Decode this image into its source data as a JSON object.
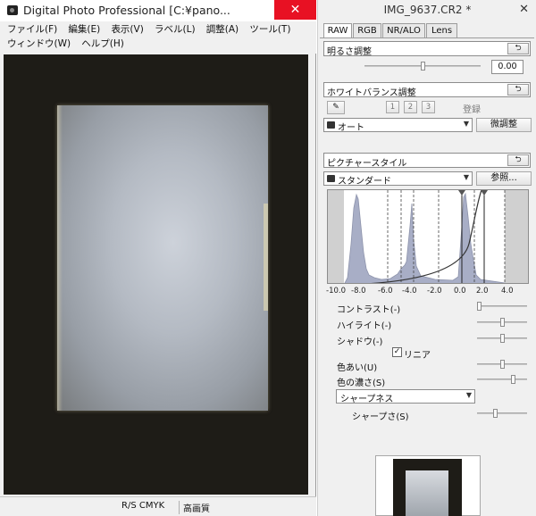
{
  "main_window": {
    "title": "Digital Photo Professional   [C:¥pano...",
    "close_glyph": "✕",
    "menu_row_1": [
      "ファイル(F)",
      "編集(E)",
      "表示(V)",
      "ラベル(L)",
      "調整(A)",
      "ツール(T)"
    ],
    "menu_row_2": [
      "ウィンドウ(W)",
      "ヘルプ(H)"
    ],
    "status": {
      "color_mode": "R/S CMYK",
      "quality": "高画質"
    }
  },
  "tool_palette": {
    "title": "IMG_9637.CR2 *",
    "close_glyph": "✕",
    "tabs": [
      "RAW",
      "RGB",
      "NR/ALO",
      "Lens"
    ],
    "active_tab": "RAW",
    "brightness": {
      "header": "明るさ調整",
      "reset_glyph": "⮌",
      "value": "0.00"
    },
    "white_balance": {
      "header": "ホワイトバランス調整",
      "reset_glyph": "⮌",
      "eyedropper_glyph": "✎",
      "presets": [
        "1",
        "2",
        "3"
      ],
      "register_label": "登録",
      "mode": "オート",
      "fine_tune_label": "微調整"
    },
    "picture_style": {
      "header": "ピクチャースタイル",
      "reset_glyph": "⮌",
      "style": "スタンダード",
      "browse_label": "参照..."
    },
    "histogram_axis": [
      "-10.0",
      "-8.0",
      "-6.0",
      "-4.0",
      "-2.0",
      "0.0",
      "2.0",
      "4.0"
    ],
    "adjustments": {
      "contrast": "コントラスト(-)",
      "highlight": "ハイライト(-)",
      "shadow": "シャドウ(-)",
      "linear": "リニア",
      "color_tone": "色あい(U)",
      "color_saturation": "色の濃さ(S)",
      "sharpness_mode": "シャープネス",
      "sharpness_strength": "シャープさ(S)"
    },
    "slider_levels": {
      "brightness": 0.5,
      "contrast": 0.0,
      "highlight": 0.5,
      "shadow": 0.5,
      "color_tone": 0.5,
      "color_saturation": 0.75,
      "sharpness_strength": 0.35
    }
  }
}
